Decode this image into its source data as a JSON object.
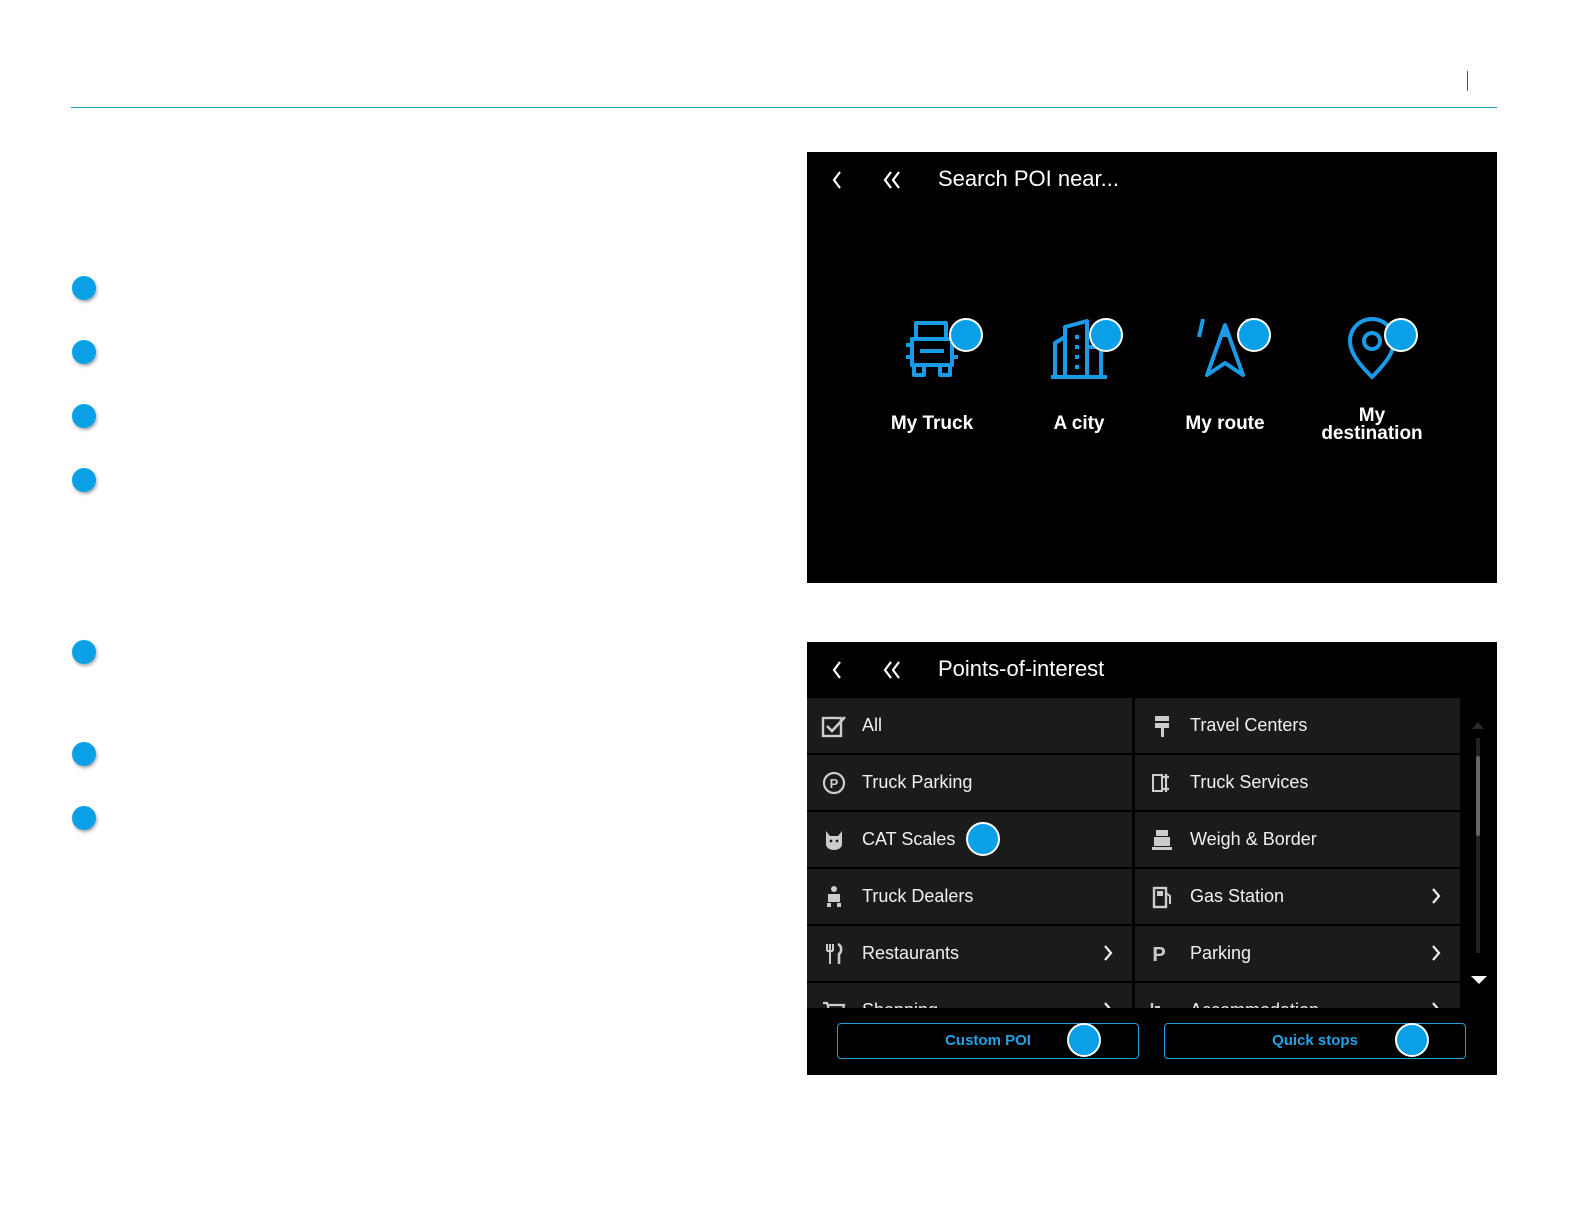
{
  "colors": {
    "accent": "#0aa0e8",
    "rule": "#1aa3d6",
    "screen_bg": "#000000",
    "row_bg": "#1b1b1b",
    "button_border": "#1e9ee0"
  },
  "search_screen": {
    "title": "Search POI near...",
    "back_icon": "chevron-left-icon",
    "home_icon": "double-chevron-left-icon",
    "options": [
      {
        "label": "My Truck",
        "icon": "truck-icon"
      },
      {
        "label": "A city",
        "icon": "city-icon"
      },
      {
        "label": "My route",
        "icon": "route-icon"
      },
      {
        "label_line1": "My",
        "label_line2": "destination",
        "icon": "destination-pin-icon"
      }
    ]
  },
  "poi_screen": {
    "title": "Points-of-interest",
    "categories": [
      {
        "label": "All",
        "icon": "checklist-icon",
        "has_submenu": false
      },
      {
        "label": "Travel Centers",
        "icon": "travel-center-sign-icon",
        "has_submenu": false
      },
      {
        "label": "Truck Parking",
        "icon": "parking-circle-icon",
        "has_submenu": false
      },
      {
        "label": "Truck Services",
        "icon": "truck-service-icon",
        "has_submenu": false
      },
      {
        "label": "CAT Scales",
        "icon": "cat-scale-icon",
        "has_submenu": false
      },
      {
        "label": "Weigh & Border",
        "icon": "weigh-station-icon",
        "has_submenu": false
      },
      {
        "label": "Truck Dealers",
        "icon": "truck-dealer-icon",
        "has_submenu": false
      },
      {
        "label": "Gas Station",
        "icon": "fuel-pump-icon",
        "has_submenu": true
      },
      {
        "label": "Restaurants",
        "icon": "fork-knife-icon",
        "has_submenu": true
      },
      {
        "label": "Parking",
        "icon": "parking-p-icon",
        "has_submenu": true
      },
      {
        "label": "Shopping",
        "icon": "shopping-cart-icon",
        "has_submenu": true
      },
      {
        "label": "Accommodation",
        "icon": "bed-icon",
        "has_submenu": true
      }
    ],
    "buttons": {
      "custom_poi": "Custom POI",
      "quick_stops": "Quick stops"
    }
  }
}
